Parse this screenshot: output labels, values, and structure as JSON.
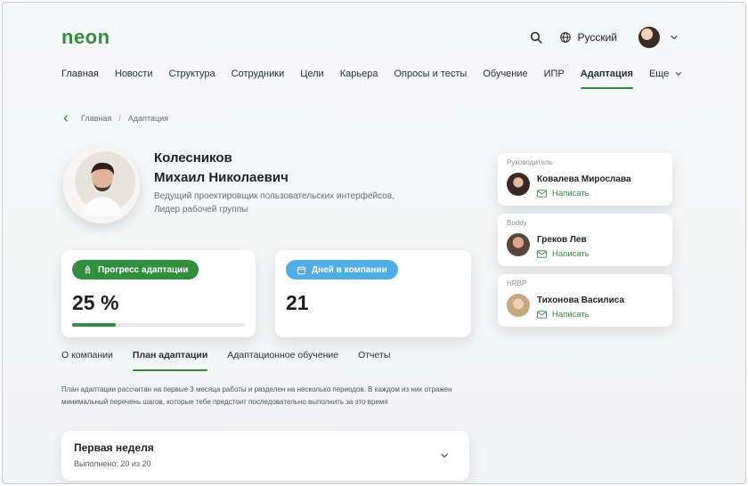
{
  "header": {
    "logo": "neon",
    "language": "Русский",
    "icons": {
      "search": "search-icon",
      "globe": "globe-icon",
      "chevron": "chevron-down-icon"
    }
  },
  "nav": {
    "items": [
      {
        "label": "Главная"
      },
      {
        "label": "Новости"
      },
      {
        "label": "Структура"
      },
      {
        "label": "Сотрудники"
      },
      {
        "label": "Цели"
      },
      {
        "label": "Карьера"
      },
      {
        "label": "Опросы и тесты"
      },
      {
        "label": "Обучение"
      },
      {
        "label": "ИПР"
      },
      {
        "label": "Адаптация",
        "active": true
      }
    ],
    "more_label": "Еще"
  },
  "breadcrumb": {
    "home": "Главная",
    "separator": "/",
    "current": "Адаптация"
  },
  "profile": {
    "last_name": "Колесников",
    "first_name": "Михаил Николаевич",
    "position": "Ведущий проектировщик пользовательских интерфейсов,",
    "role": "Лидер рабочей группы"
  },
  "stats": {
    "progress": {
      "label": "Прогресс адаптации",
      "value": "25 %",
      "fraction": 0.25,
      "color": "#2f8f3d"
    },
    "days": {
      "label": "Дней в компании",
      "value": "21",
      "color": "#4faee6"
    }
  },
  "contacts": [
    {
      "label": "Руководитель",
      "name": "Ковалева Мирослава",
      "action": "Написать"
    },
    {
      "label": "Buddy",
      "name": "Греков Лев",
      "action": "Написать"
    },
    {
      "label": "HRBP",
      "name": "Тихонова Василиса",
      "action": "Написать"
    }
  ],
  "tabs": [
    {
      "label": "О компании"
    },
    {
      "label": "План адаптации",
      "active": true
    },
    {
      "label": "Адаптационное обучение"
    },
    {
      "label": "Отчеты"
    }
  ],
  "plan_description": "План адаптации рассчитан на первые 3 месяца работы и разделен на несколько периодов. В каждом из них отражен минимальный перечень шагов, которые тебе предстоит последовательно выполнить за это время",
  "accordion": {
    "title": "Первая неделя",
    "completed": "Выполнено: 20 из 20"
  },
  "colors": {
    "accent": "#2f8f3d",
    "blue": "#4faee6"
  }
}
